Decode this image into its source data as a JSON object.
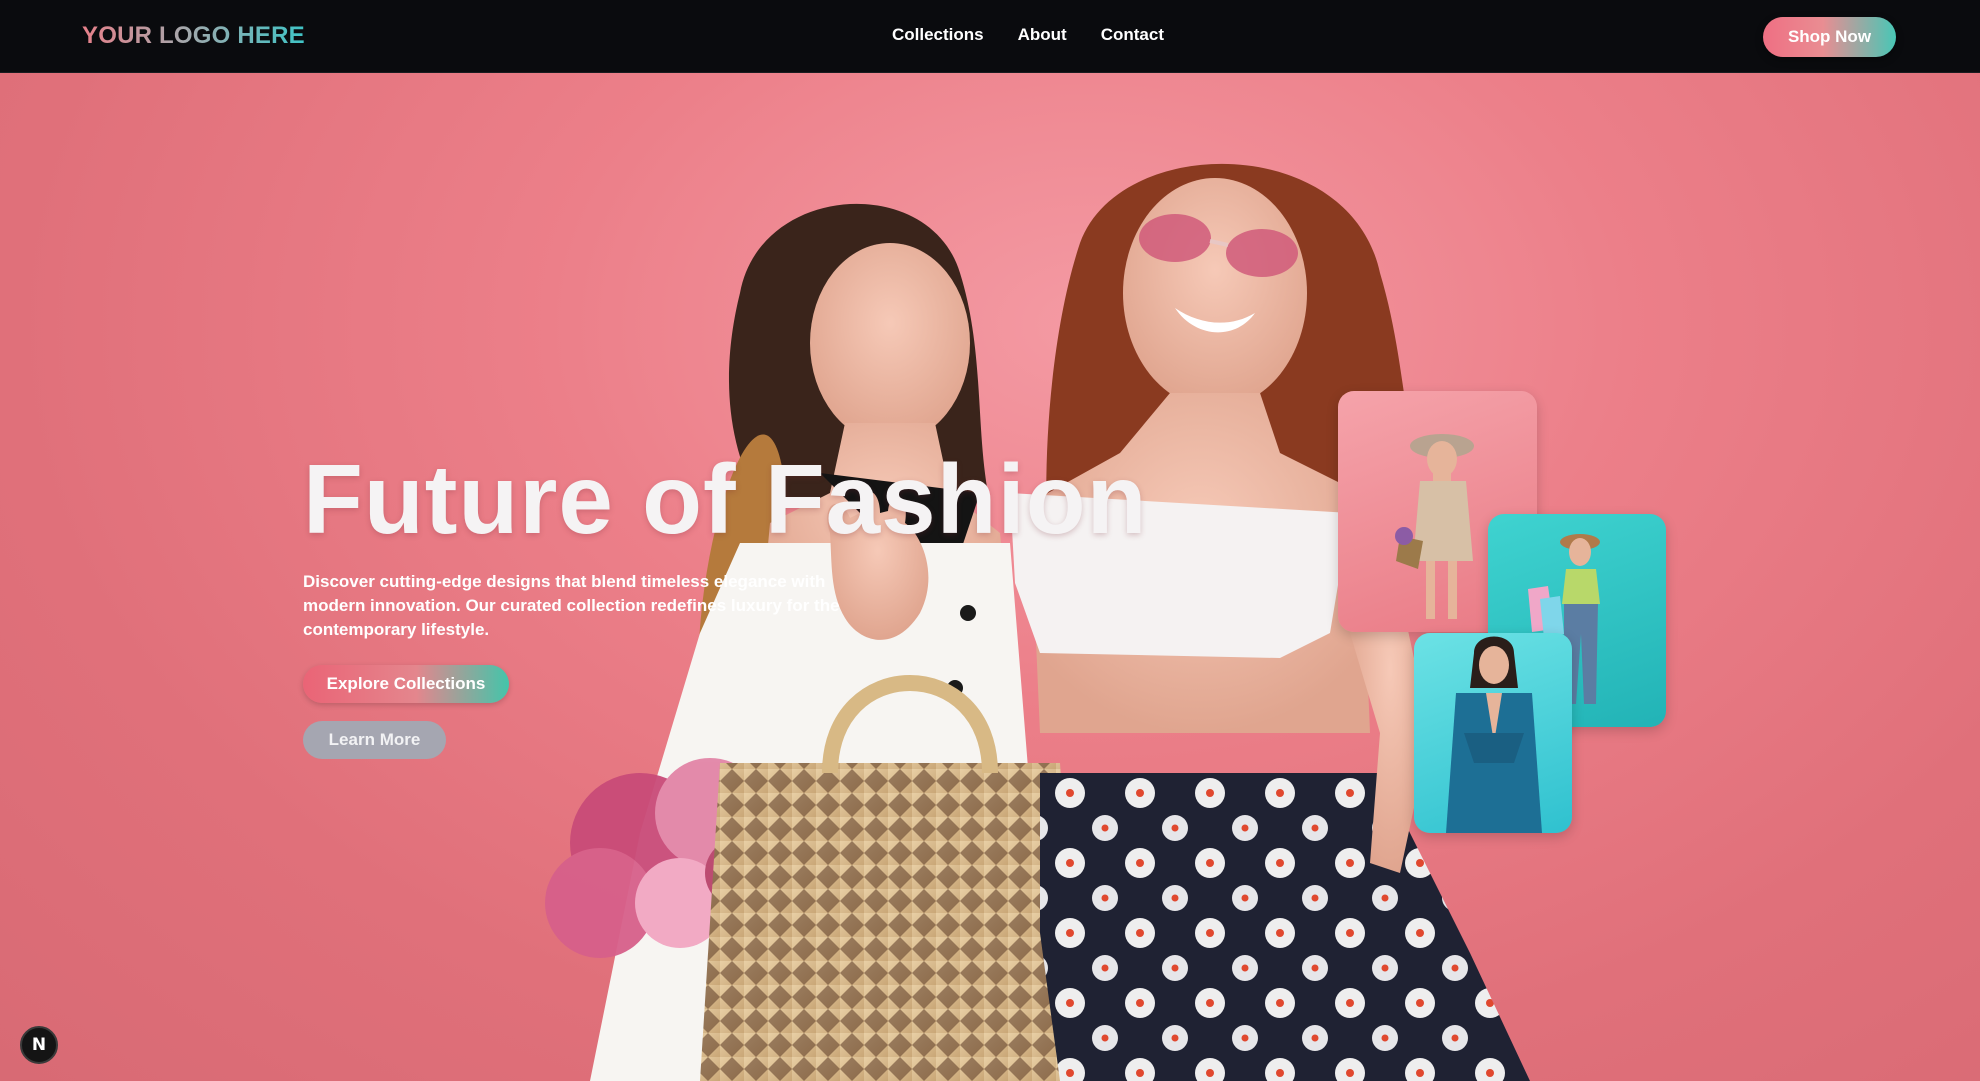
{
  "nav": {
    "logo": "YOUR LOGO HERE",
    "links": [
      "Collections",
      "About",
      "Contact"
    ],
    "cta": "Shop Now"
  },
  "hero": {
    "title": "Future of Fashion",
    "description": "Discover cutting-edge designs that blend timeless elegance with modern innovation. Our curated collection redefines luxury for the contemporary lifestyle.",
    "primary_button": "Explore Collections",
    "secondary_button": "Learn More"
  },
  "badge": {
    "letter": "N"
  },
  "colors": {
    "navbar_bg": "#0a0b0e",
    "hero_bg": "#e8737e",
    "accent_pink": "#ef6f83",
    "accent_teal": "#48c7b6",
    "secondary_button": "#a5a6b1"
  },
  "icons": {
    "badge": "next-n-icon"
  }
}
